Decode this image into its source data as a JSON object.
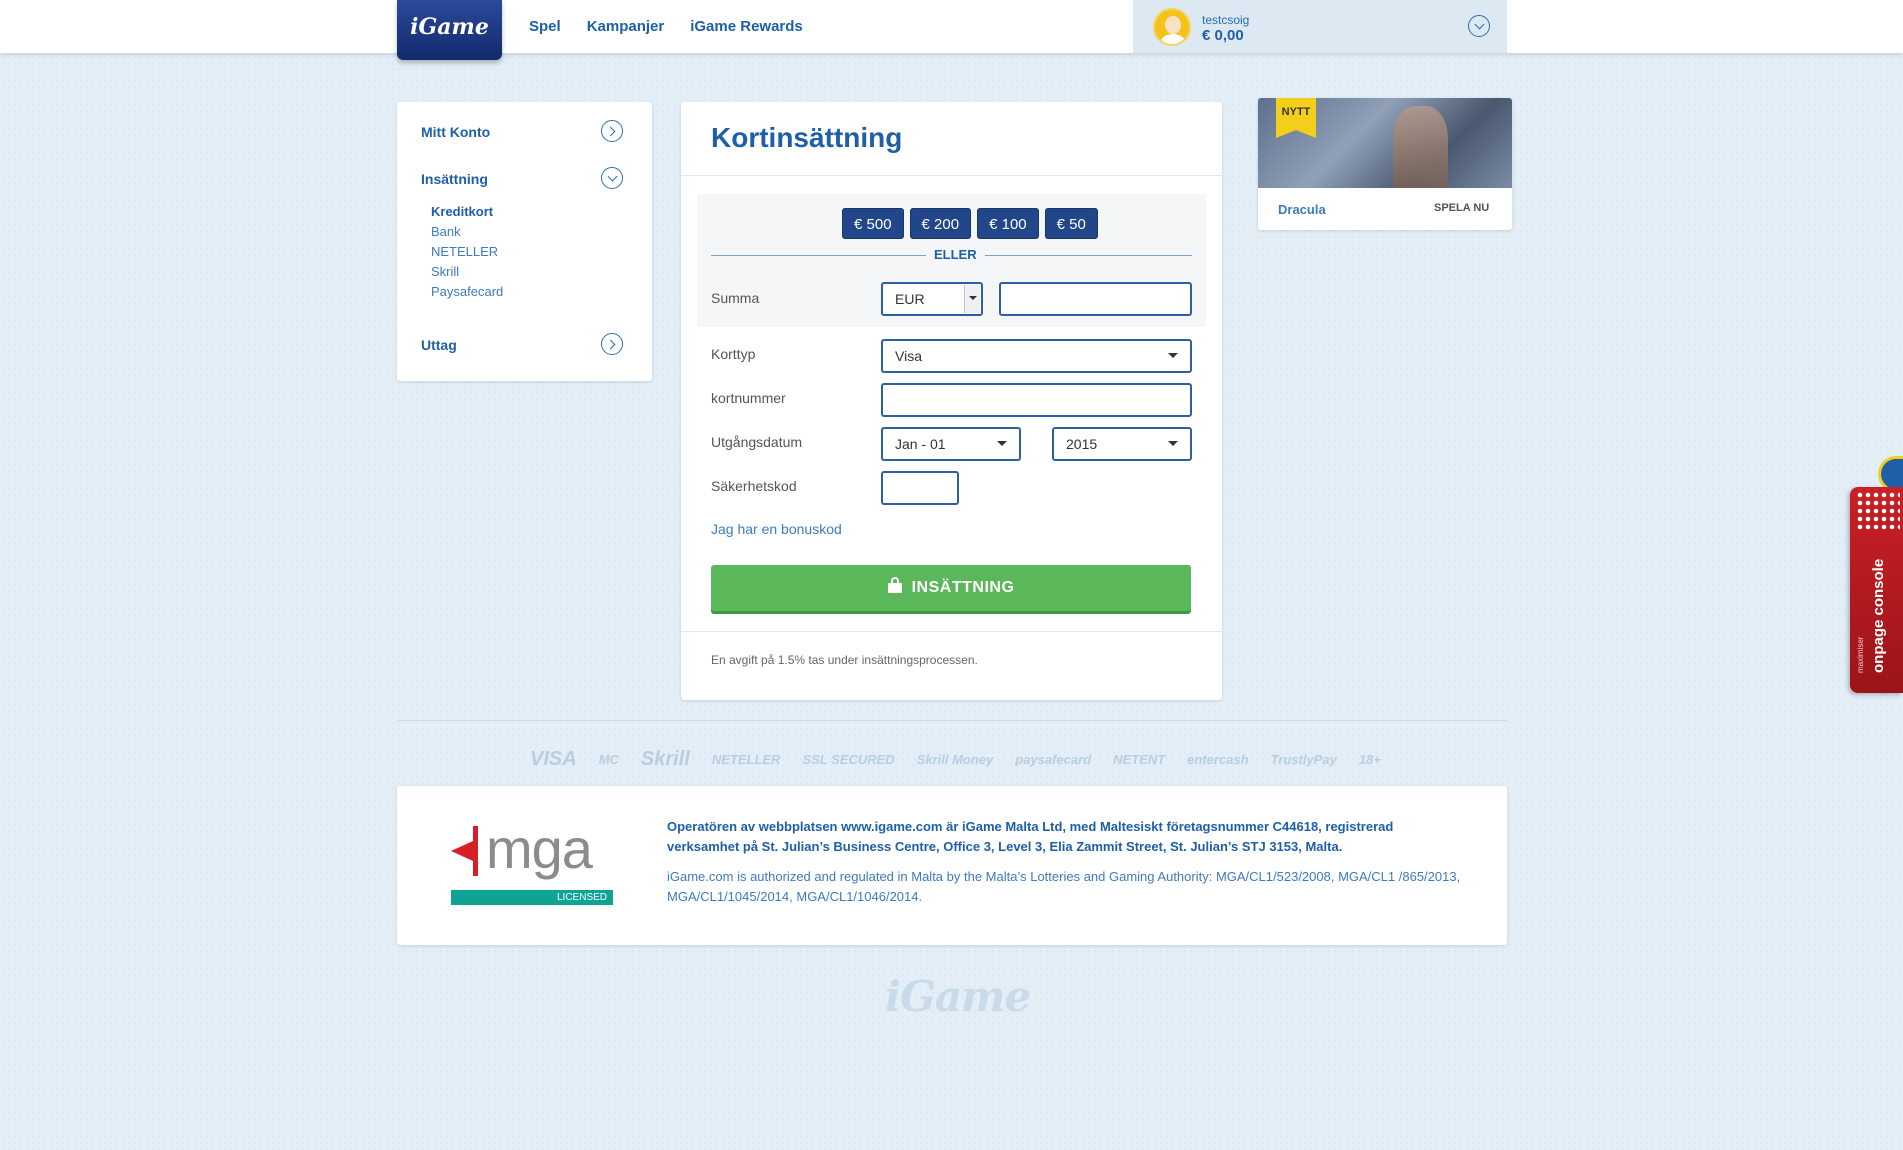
{
  "header": {
    "logo_text": "iGame",
    "nav": [
      "Spel",
      "Kampanjer",
      "iGame Rewards"
    ],
    "user": {
      "name": "testcsoig",
      "balance": "€ 0,00"
    }
  },
  "sidebar": {
    "sections": {
      "mitt_konto": "Mitt Konto",
      "insattning": "Insättning",
      "uttag": "Uttag"
    },
    "sub_items": [
      "Kreditkort",
      "Bank",
      "NETELLER",
      "Skrill",
      "Paysafecard"
    ],
    "active_sub": "Kreditkort"
  },
  "form": {
    "title": "Kortinsättning",
    "presets": [
      "€ 500",
      "€ 200",
      "€ 100",
      "€ 50"
    ],
    "or_label": "ELLER",
    "summa_label": "Summa",
    "currency": "EUR",
    "amount_value": "",
    "korttyp_label": "Korttyp",
    "korttyp_value": "Visa",
    "kortnummer_label": "kortnummer",
    "kortnummer_value": "",
    "utgangsdatum_label": "Utgångsdatum",
    "month_value": "Jan - 01",
    "year_value": "2015",
    "sakerhetskod_label": "Säkerhetskod",
    "sakerhetskod_value": "",
    "bonus_link": "Jag har en bonuskod",
    "submit_label": "INSÄTTNING",
    "fee_note": "En avgift på 1.5% tas under insättningsprocessen."
  },
  "promo": {
    "badge": "NYTT",
    "game_name": "Dracula",
    "play_label": "SPELA NU"
  },
  "footer": {
    "payment_logos": [
      "VISA",
      "MC",
      "Skrill",
      "NETELLER",
      "SSL SECURED",
      "Skrill Money",
      "paysafecard",
      "NETENT",
      "entercash",
      "TrustlyPay",
      "18+"
    ],
    "mga_text": "mga",
    "mga_licensed": "LICENSED",
    "legal_bold": "Operatören av webbplatsen www.igame.com är iGame Malta Ltd, med Maltesiskt företagsnummer C44618, registrerad verksamhet på St. Julian’s Business Centre, Office 3, Level 3, Elia Zammit Street, St. Julian’s STJ 3153, Malta.",
    "legal_text": "iGame.com is authorized and regulated in Malta by the Malta’s Lotteries and Gaming Authority: MGA/CL1/523/2008, MGA/CL1 /865/2013, MGA/CL1/1045/2014, MGA/CL1/1046/2014.",
    "footer_logo": "iGame"
  },
  "console": {
    "title": "onpage console",
    "small": "maximiser"
  },
  "colors": {
    "brand_blue": "#1f5fa8",
    "navy_button": "#21478a",
    "submit_green": "#5bb85a",
    "background": "#e3eef7"
  }
}
